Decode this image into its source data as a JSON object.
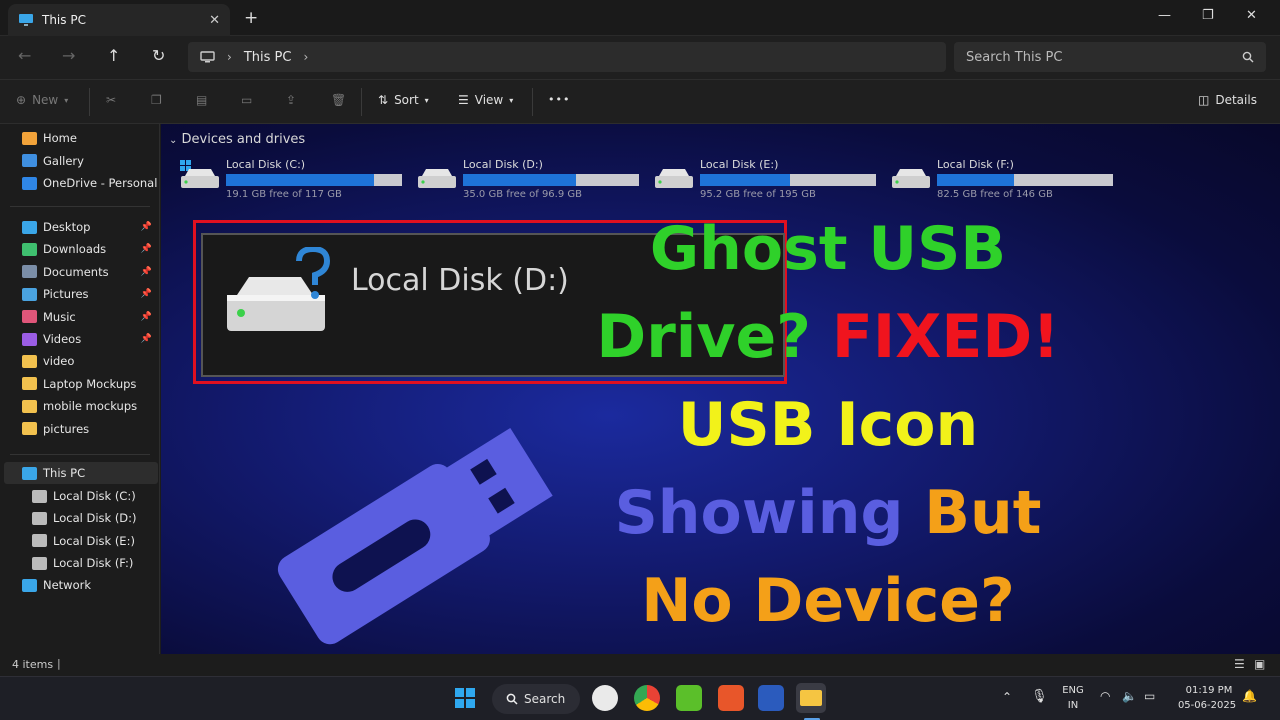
{
  "window": {
    "tab_title": "This PC",
    "tab_close": "✕",
    "new_tab": "+",
    "minimize": "—",
    "maximize": "❐",
    "close": "✕"
  },
  "nav": {
    "breadcrumb": "This PC",
    "search_placeholder": "Search This PC"
  },
  "toolbar": {
    "new_label": "New",
    "sort_label": "Sort",
    "view_label": "View",
    "more_label": "•••",
    "details_label": "Details"
  },
  "sidebar": {
    "quick": [
      {
        "label": "Home",
        "color": "#f2a33a"
      },
      {
        "label": "Gallery",
        "color": "#3f8fe0"
      },
      {
        "label": "OneDrive - Personal",
        "color": "#2f86e6"
      }
    ],
    "pinned": [
      {
        "label": "Desktop",
        "color": "#3aa6e8",
        "pinned": true
      },
      {
        "label": "Downloads",
        "color": "#3fbf6f",
        "pinned": true
      },
      {
        "label": "Documents",
        "color": "#7b8ea8",
        "pinned": true
      },
      {
        "label": "Pictures",
        "color": "#4aa3e0",
        "pinned": true
      },
      {
        "label": "Music",
        "color": "#e0567a",
        "pinned": true
      },
      {
        "label": "Videos",
        "color": "#9b5de5",
        "pinned": true
      },
      {
        "label": "video",
        "color": "#f2c14e",
        "pinned": false
      },
      {
        "label": "Laptop Mockups",
        "color": "#f2c14e",
        "pinned": false
      },
      {
        "label": "mobile mockups",
        "color": "#f2c14e",
        "pinned": false
      },
      {
        "label": "pictures",
        "color": "#f2c14e",
        "pinned": false
      }
    ],
    "this_pc": "This PC",
    "drives": [
      "Local Disk (C:)",
      "Local Disk (D:)",
      "Local Disk (E:)",
      "Local Disk (F:)"
    ],
    "network": "Network"
  },
  "content": {
    "section_title": "Devices and drives",
    "drives": [
      {
        "name": "Local Disk (C:)",
        "free": "19.1 GB free of 117 GB",
        "used_fraction": 0.84
      },
      {
        "name": "Local Disk (D:)",
        "free": "35.0 GB free of 96.9 GB",
        "used_fraction": 0.64
      },
      {
        "name": "Local Disk (E:)",
        "free": "95.2 GB free of 195 GB",
        "used_fraction": 0.51
      },
      {
        "name": "Local Disk (F:)",
        "free": "82.5 GB free of 146 GB",
        "used_fraction": 0.44
      }
    ],
    "highlight_label": "Local Disk (D:)",
    "question_mark": "?"
  },
  "headline": {
    "line1": "Ghost USB",
    "line2a": "Drive?",
    "line2b": "FIXED!",
    "line3": "USB Icon",
    "line4a": "Showing",
    "line4b": "But",
    "line5": "No Device?",
    "colors": {
      "green": "#2fd12a",
      "red": "#f0141e",
      "yellow": "#f2f21a",
      "blue": "#5a5ee0",
      "orange": "#f4a018"
    }
  },
  "status": {
    "items_count": "4 items"
  },
  "taskbar": {
    "search_label": "Search",
    "lang_top": "ENG",
    "lang_bottom": "IN",
    "time": "01:19 PM",
    "date": "05-06-2025"
  }
}
